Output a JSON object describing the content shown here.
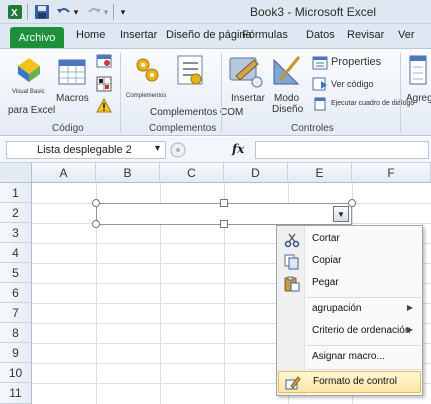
{
  "window": {
    "title": "Book3 - Microsoft Excel"
  },
  "quick_access": {
    "undo_arrow": "▾",
    "redo_arrow": "▾",
    "customize": "▾"
  },
  "tabs": [
    "Archivo",
    "Home",
    "Insertar",
    "Diseño de página",
    "Fórmulas",
    "Datos",
    "Revisar",
    "Ver"
  ],
  "ribbon": {
    "codigo": {
      "visual_basic": "Visual Basic",
      "para_excel": "para Excel",
      "macros": "Macros",
      "group": "Código"
    },
    "complementos": {
      "complementos_btn": "Complementos",
      "com": "Complementos COM",
      "group": "Complementos"
    },
    "controles": {
      "insertar": "Insertar",
      "modo": "Modo",
      "diseno": "Diseño",
      "properties": "Properties",
      "ver_codigo": "Ver código",
      "ejecutar": "Ejecutar cuadro de diálogo",
      "group": "Controles"
    },
    "extra": {
      "agreg": "Agreg"
    }
  },
  "formula_bar": {
    "name_box": "Lista desplegable 2",
    "name_box_arrow": "▾",
    "fx": "fx"
  },
  "grid": {
    "columns": [
      "A",
      "B",
      "C",
      "D",
      "E",
      "F"
    ],
    "rows": [
      "1",
      "2",
      "3",
      "4",
      "5",
      "6",
      "7",
      "8",
      "9",
      "10",
      "11"
    ]
  },
  "combo": {
    "arrow": "▼"
  },
  "context_menu": {
    "items": [
      {
        "label": "Cortar"
      },
      {
        "label": "Copiar"
      },
      {
        "label": "Pegar"
      },
      {
        "label": "agrupación",
        "arrow": "▶"
      },
      {
        "label": "Criterio de ordenación",
        "arrow": "▶"
      },
      {
        "label": "Asignar macro..."
      },
      {
        "label": "Formato de control"
      }
    ]
  },
  "colors": {
    "file_tab": "#1e8f3a",
    "highlight": "#fde6a3",
    "ribbon": "#e4ebf5"
  }
}
